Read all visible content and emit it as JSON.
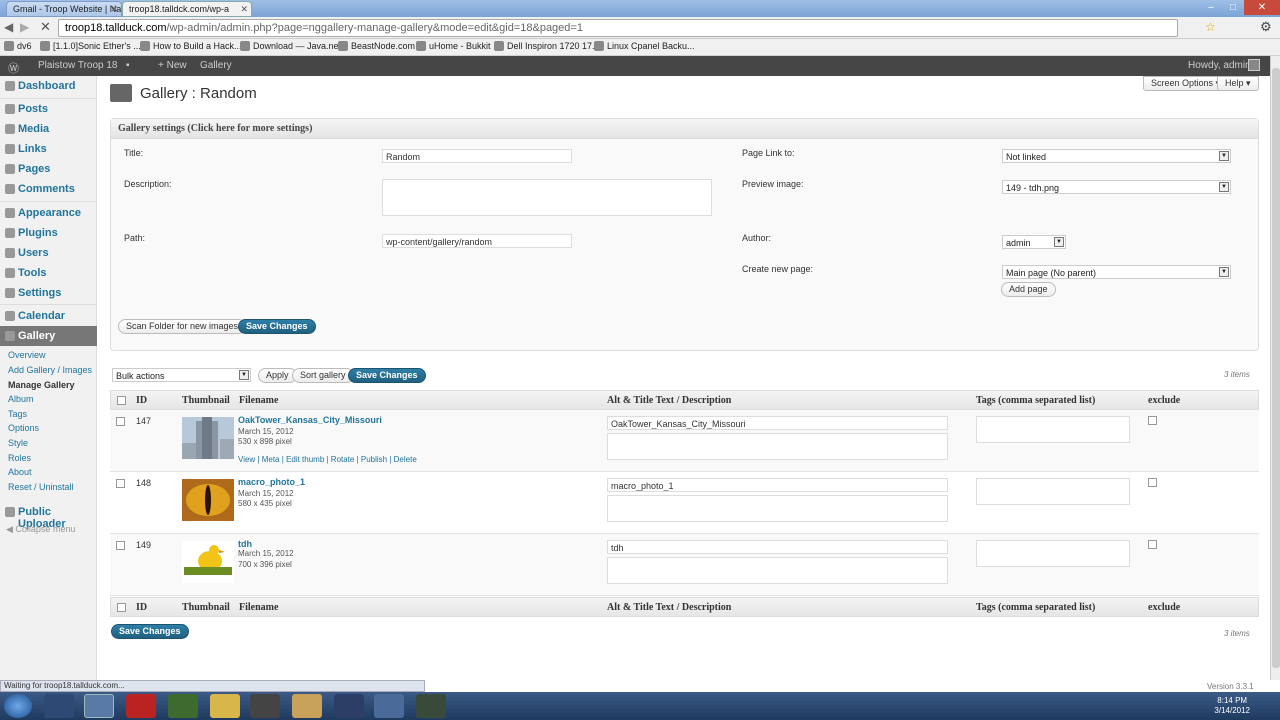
{
  "browser": {
    "tabs": [
      {
        "label": "Gmail - Troop Website | Na"
      },
      {
        "label": "troop18.talldck.com/wp-a"
      }
    ],
    "url_host": "troop18.tallduck.com",
    "url_rest": "/wp-admin/admin.php?page=nggallery-manage-gallery&mode=edit&gid=18&paged=1",
    "bookmarks": [
      "dv6",
      "[1.1.0]Sonic Ether's ...",
      "How to Build a Hack...",
      "Download — Java.net",
      "BeastNode.com",
      "uHome - Bukkit",
      "Dell Inspiron 1720 17...",
      "Linux Cpanel Backu..."
    ],
    "status": "Waiting for troop18.tallduck.com..."
  },
  "adminbar": {
    "site": "Plaistow Troop 18",
    "new": "+ New",
    "gallery": "Gallery",
    "howdy": "Howdy, admin"
  },
  "menu": {
    "items": [
      {
        "label": "Dashboard"
      },
      {
        "label": "Posts"
      },
      {
        "label": "Media"
      },
      {
        "label": "Links"
      },
      {
        "label": "Pages"
      },
      {
        "label": "Comments"
      },
      {
        "label": "Appearance"
      },
      {
        "label": "Plugins"
      },
      {
        "label": "Users"
      },
      {
        "label": "Tools"
      },
      {
        "label": "Settings"
      },
      {
        "label": "Calendar"
      },
      {
        "label": "Gallery"
      }
    ],
    "sub": [
      "Overview",
      "Add Gallery / Images",
      "Manage Gallery",
      "Album",
      "Tags",
      "Options",
      "Style",
      "Roles",
      "About",
      "Reset / Uninstall"
    ],
    "uploader": "Public Uploader",
    "collapse": "Collapse menu"
  },
  "page": {
    "title": "Gallery : Random",
    "screen_options": "Screen Options ▾",
    "help": "Help ▾"
  },
  "settings": {
    "header": "Gallery settings (Click here for more settings)",
    "title_label": "Title:",
    "title_value": "Random",
    "desc_label": "Description:",
    "path_label": "Path:",
    "path_value": "wp-content/gallery/random",
    "pagelink_label": "Page Link to:",
    "pagelink_value": "Not linked",
    "preview_label": "Preview image:",
    "preview_value": "149 - tdh.png",
    "author_label": "Author:",
    "author_value": "admin",
    "newpage_label": "Create new page:",
    "newpage_value": "Main page (No parent)",
    "add_page": "Add page",
    "scan": "Scan Folder for new images",
    "save": "Save Changes"
  },
  "toolbar": {
    "bulk": "Bulk actions",
    "apply": "Apply",
    "sort": "Sort gallery",
    "save": "Save Changes",
    "count": "3 items"
  },
  "columns": {
    "id": "ID",
    "thumb": "Thumbnail",
    "file": "Filename",
    "alt": "Alt & Title Text / Description",
    "tags": "Tags (comma separated list)",
    "exclude": "exclude"
  },
  "rows": [
    {
      "id": "147",
      "name": "OakTower_Kansas_City_Missouri",
      "date": "March 15, 2012",
      "size": "530 x 898 pixel",
      "alt": "OakTower_Kansas_City_Missouri",
      "actions": "View | Meta | Edit thumb | Rotate | Publish | Delete"
    },
    {
      "id": "148",
      "name": "macro_photo_1",
      "date": "March 15, 2012",
      "size": "580 x 435 pixel",
      "alt": "macro_photo_1"
    },
    {
      "id": "149",
      "name": "tdh",
      "date": "March 15, 2012",
      "size": "700 x 396 pixel",
      "alt": "tdh"
    }
  ],
  "bottom": {
    "save": "Save Changes",
    "count": "3 items"
  },
  "footer": {
    "version": "Version 3.3.1"
  },
  "taskbar": {
    "time": "8:14 PM",
    "date": "3/14/2012"
  }
}
